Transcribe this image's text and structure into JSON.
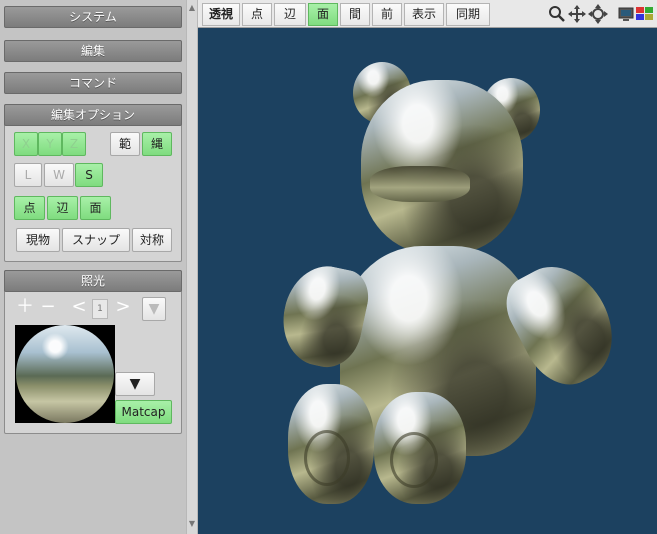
{
  "sidebar": {
    "system_label": "システム",
    "edit_label": "編集",
    "command_label": "コマンド",
    "edit_options": {
      "title": "編集オプション",
      "axis": {
        "x": "X",
        "y": "Y",
        "z": "Z"
      },
      "range": "範",
      "rope": "縄",
      "l": "L",
      "w": "W",
      "s": "S",
      "point": "点",
      "edge": "辺",
      "face": "面",
      "current": "現物",
      "snap": "スナップ",
      "symmetry": "対称"
    },
    "lighting": {
      "title": "照光",
      "index": "1",
      "matcap": "Matcap"
    }
  },
  "toolbar": {
    "perspective": "透視",
    "point": "点",
    "edge": "辺",
    "face": "面",
    "mid": "間",
    "front": "前",
    "display": "表示",
    "sync": "同期"
  },
  "colors": {
    "viewport_bg": "#1c4160",
    "active_green": "#80dc80",
    "header_gray": "#8a8a8a"
  }
}
